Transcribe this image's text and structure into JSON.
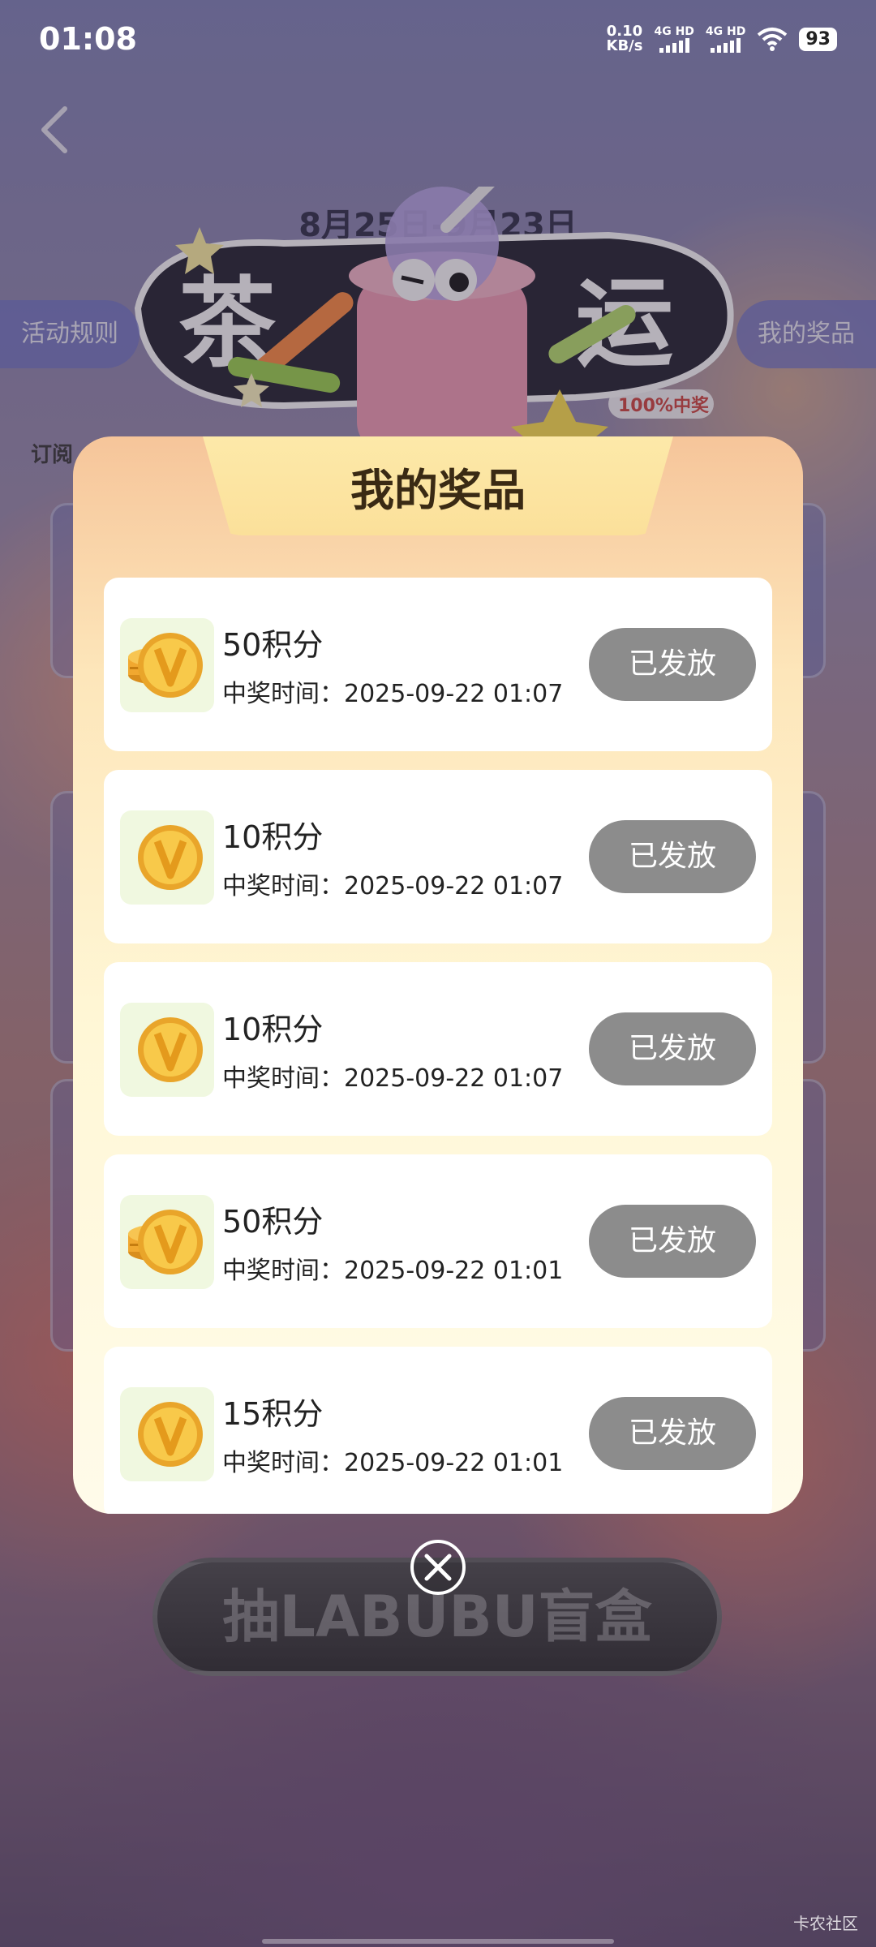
{
  "status_bar": {
    "time": "01:08",
    "net_speed_value": "0.10",
    "net_speed_unit": "KB/s",
    "sim1": "4G HD",
    "sim2": "4G HD",
    "battery": "93"
  },
  "background": {
    "date_range": "8月25日-9月23日",
    "activity_rules_label": "活动规则",
    "my_prizes_label": "我的奖品",
    "subscribe_tag": "订阅",
    "badge_100": "100%中奖",
    "bottom_button": "抽LABUBU盲盒"
  },
  "modal": {
    "title": "我的奖品",
    "prizes": [
      {
        "name": "50积分",
        "time": "中奖时间：2025-09-22 01:07",
        "status": "已发放",
        "icon": "coin-stack-icon"
      },
      {
        "name": "10积分",
        "time": "中奖时间：2025-09-22 01:07",
        "status": "已发放",
        "icon": "coin-icon"
      },
      {
        "name": "10积分",
        "time": "中奖时间：2025-09-22 01:07",
        "status": "已发放",
        "icon": "coin-icon"
      },
      {
        "name": "50积分",
        "time": "中奖时间：2025-09-22 01:01",
        "status": "已发放",
        "icon": "coin-stack-icon"
      },
      {
        "name": "15积分",
        "time": "中奖时间：2025-09-22 01:01",
        "status": "已发放",
        "icon": "coin-icon"
      }
    ]
  },
  "watermark": "卡农社区",
  "colors": {
    "status_button": "#8c8c8c",
    "coin_gold": "#f5b83a",
    "modal_top": "#f6c59a",
    "modal_bottom": "#fffbea"
  }
}
